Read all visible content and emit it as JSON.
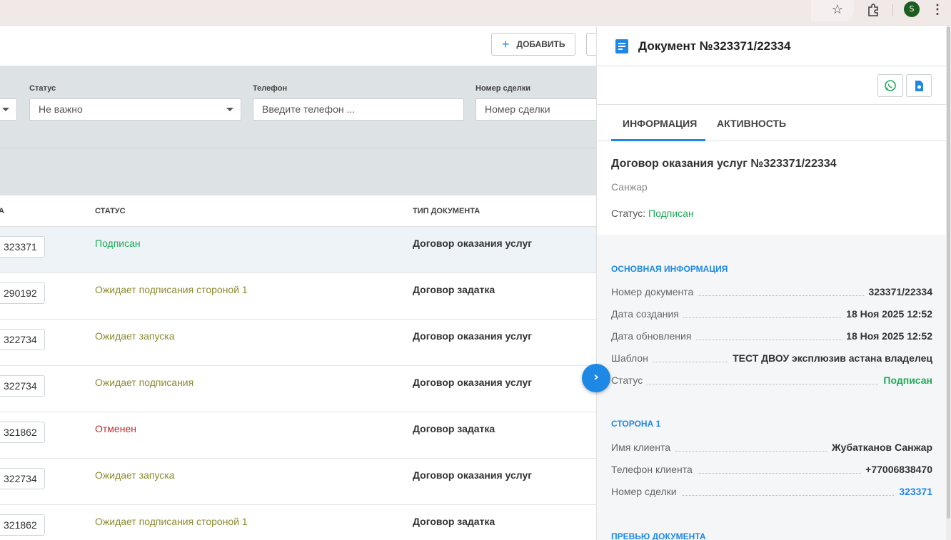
{
  "toolbar": {
    "add_label": "ДОБАВИТЬ"
  },
  "filters": {
    "status": {
      "label": "Статус",
      "value": "Не важно"
    },
    "phone": {
      "label": "Телефон",
      "placeholder": "Введите телефон ..."
    },
    "deal": {
      "label": "Номер сделки",
      "placeholder": "Номер сделки"
    }
  },
  "table": {
    "headers": [
      "А",
      "СТАТУС",
      "ТИП ДОКУМЕНТА"
    ],
    "rows": [
      {
        "deal": "323371",
        "status": "Подписан",
        "type": "Договор оказания услуг"
      },
      {
        "deal": "290192",
        "status": "Ожидает подписания стороной 1",
        "type": "Договор задатка"
      },
      {
        "deal": "322734",
        "status": "Ожидает запуска",
        "type": "Договор оказания услуг"
      },
      {
        "deal": "322734",
        "status": "Ожидает подписания",
        "type": "Договор оказания услуг"
      },
      {
        "deal": "321862",
        "status": "Отменен",
        "type": "Договор задатка"
      },
      {
        "deal": "322734",
        "status": "Ожидает запуска",
        "type": "Договор оказания услуг"
      },
      {
        "deal": "321862",
        "status": "Ожидает подписания стороной 1",
        "type": "Договор задатка"
      }
    ]
  },
  "panel": {
    "title": "Документ №323371/22334",
    "tabs": [
      "ИНФОРМАЦИЯ",
      "АКТИВНОСТЬ"
    ],
    "summary": {
      "title": "Договор оказания услуг №323371/22334",
      "subtitle": "Санжар",
      "status_label": "Статус: ",
      "status_value": "Подписан"
    },
    "main_info": {
      "title": "ОСНОВНАЯ ИНФОРМАЦИЯ",
      "rows": [
        {
          "key": "Номер документа",
          "value": "323371/22334"
        },
        {
          "key": "Дата создания",
          "value": "18 Ноя 2025 12:52"
        },
        {
          "key": "Дата обновления",
          "value": "18 Ноя 2025 12:52"
        },
        {
          "key": "Шаблон",
          "value": "ТЕСТ ДВОУ эксплюзив астана владелец"
        },
        {
          "key": "Статус",
          "value": "Подписан"
        }
      ]
    },
    "party1": {
      "title": "СТОРОНА 1",
      "rows": [
        {
          "key": "Имя клиента",
          "value": "Жубатканов Санжар"
        },
        {
          "key": "Телефон клиента",
          "value": "+77006838470"
        },
        {
          "key": "Номер сделки",
          "value": "323371"
        }
      ]
    },
    "preview_title": "ПРЕВЬЮ ДОКУМЕНТА"
  },
  "browser": {
    "avatar_letter": "S"
  },
  "colors": {
    "accent": "#1e88e5",
    "status_signed": "#1faa59",
    "status_waiting": "#8c8a30",
    "status_cancelled": "#c62828"
  }
}
